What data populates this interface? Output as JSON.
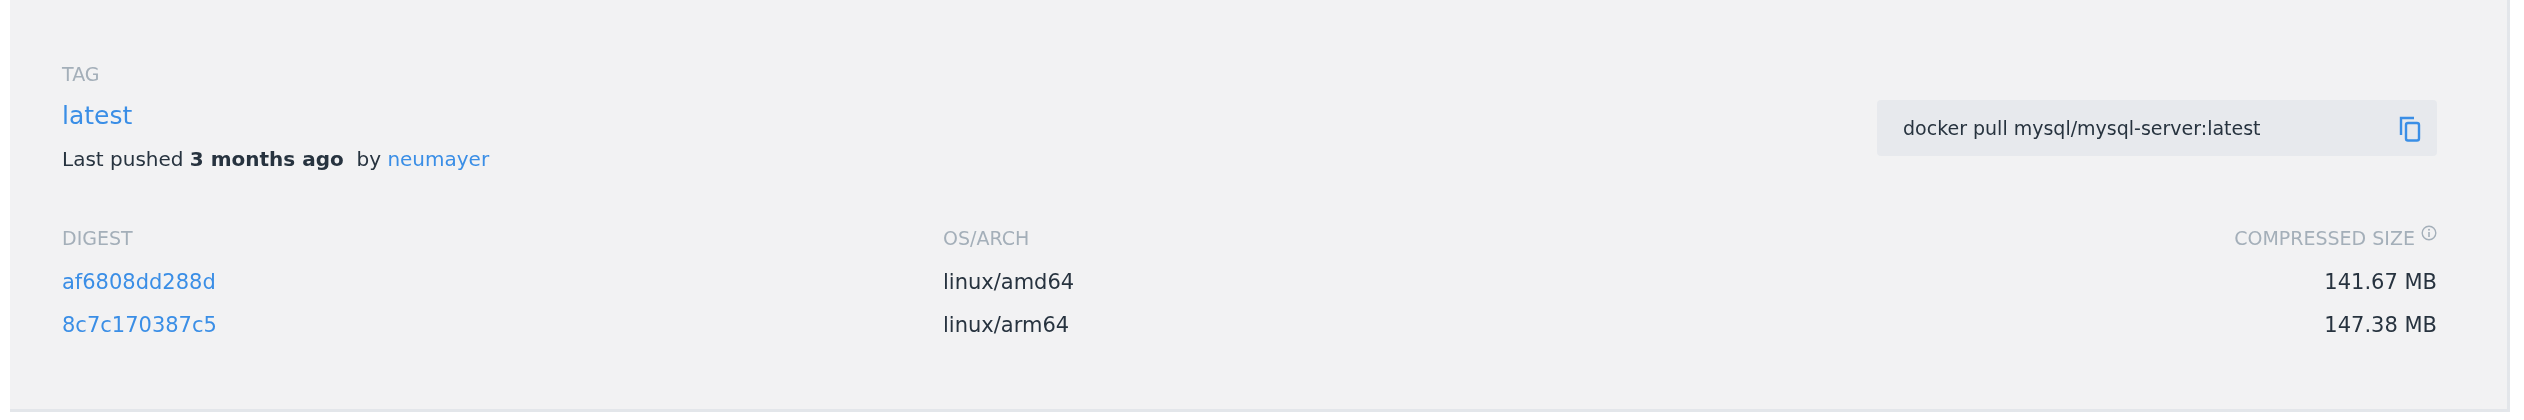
{
  "tag": {
    "label": "TAG",
    "name": "latest",
    "pushed_prefix": "Last pushed",
    "pushed_when": "3 months ago",
    "pushed_by_prefix": "by",
    "pushed_by": "neumayer"
  },
  "pull_command": "docker pull mysql/mysql-server:latest",
  "table": {
    "columns": [
      "DIGEST",
      "OS/ARCH",
      "COMPRESSED SIZE"
    ],
    "rows": [
      {
        "digest": "af6808dd288d",
        "os_arch": "linux/amd64",
        "size": "141.67 MB"
      },
      {
        "digest": "8c7c170387c5",
        "os_arch": "linux/arm64",
        "size": "147.38 MB"
      }
    ]
  }
}
